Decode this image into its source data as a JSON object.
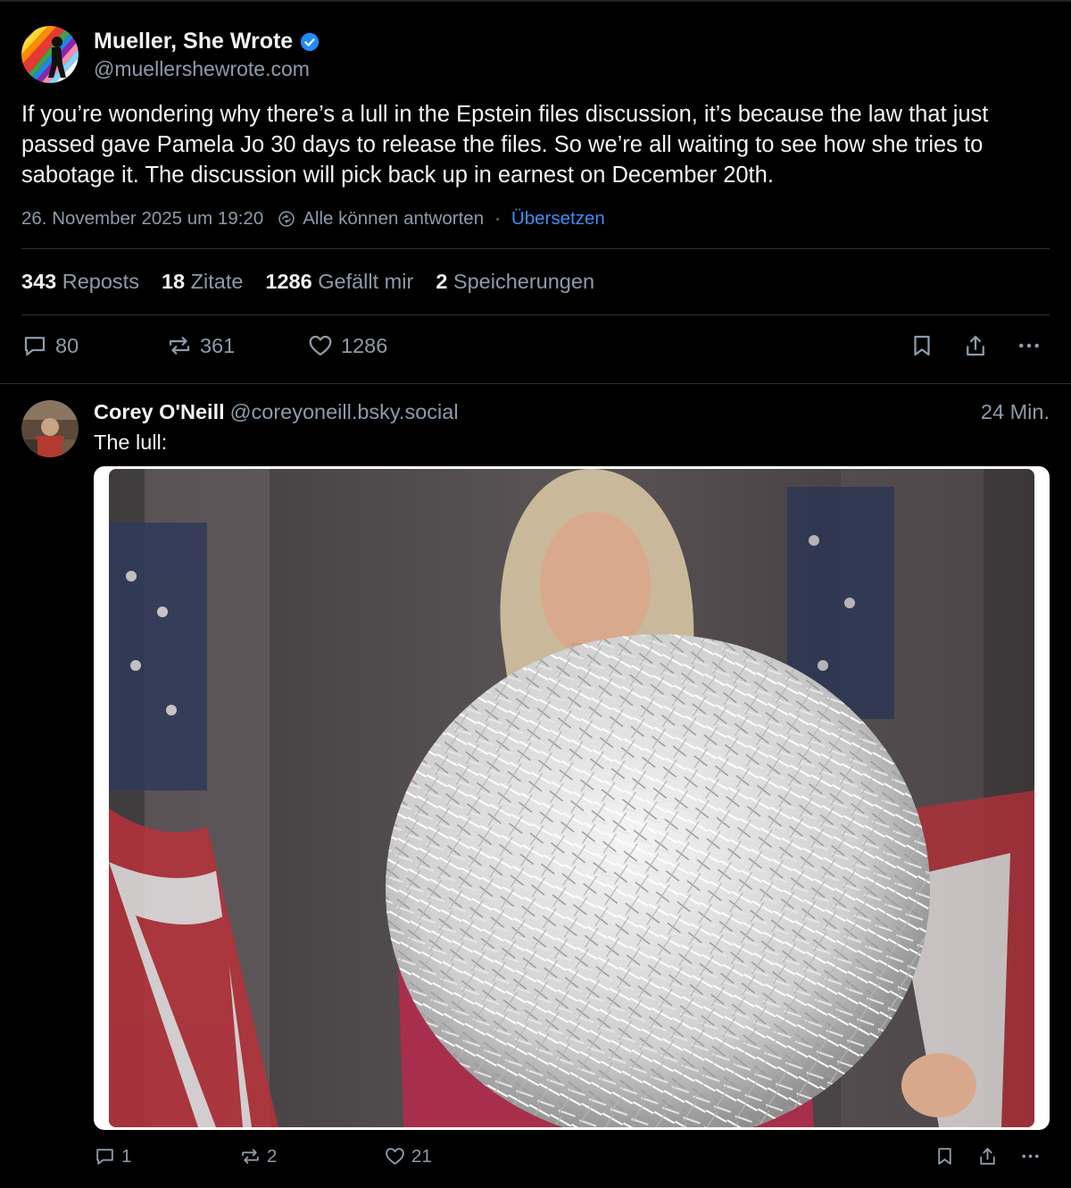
{
  "main_post": {
    "author_name": "Mueller, She Wrote",
    "author_handle": "@muellershewrote.com",
    "verified": true,
    "text": "If you’re wondering why there’s a lull in the Epstein files discussion, it’s because the law that just passed gave Pamela Jo 30 days to release the files. So we’re all waiting to see how she tries to sabotage it. The discussion will pick back up in earnest on December 20th.",
    "timestamp": "26. November 2025 um 19:20",
    "reply_setting": "Alle können antworten",
    "separator": "·",
    "translate_label": "Übersetzen",
    "stats": [
      {
        "count": "343",
        "label": "Reposts"
      },
      {
        "count": "18",
        "label": "Zitate"
      },
      {
        "count": "1286",
        "label": "Gefällt mir"
      },
      {
        "count": "2",
        "label": "Speicherungen"
      }
    ],
    "actions": {
      "replies": "80",
      "reposts": "361",
      "likes": "1286"
    }
  },
  "reply_post": {
    "author_name": "Corey O'Neill",
    "author_handle": "@coreyoneill.bsky.social",
    "time_ago": "24 Min.",
    "text": "The lull:",
    "actions": {
      "replies": "1",
      "reposts": "2",
      "likes": "21"
    }
  },
  "colors": {
    "background": "#000000",
    "text_primary": "#f1f3f5",
    "text_secondary": "#8d9baa",
    "link": "#3e8ef7",
    "verified": "#1d8cf8",
    "divider": "#2a3038"
  },
  "icons": [
    "verified-badge-icon",
    "reply-settings-icon",
    "comment-icon",
    "repost-icon",
    "heart-icon",
    "bookmark-icon",
    "share-icon",
    "more-icon"
  ]
}
